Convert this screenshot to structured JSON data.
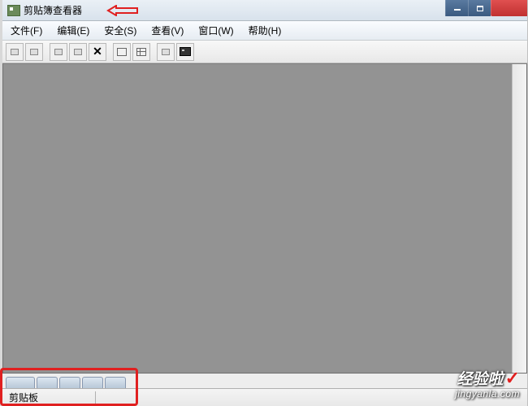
{
  "window": {
    "title": "剪贴簿查看器"
  },
  "menus": {
    "file": "文件(F)",
    "edit": "编辑(E)",
    "security": "安全(S)",
    "view": "查看(V)",
    "window": "窗口(W)",
    "help": "帮助(H)"
  },
  "statusbar": {
    "label": "剪贴板"
  },
  "watermark": {
    "main": "经验啦",
    "check": "✓",
    "sub": "jingyanla.com"
  },
  "colors": {
    "annotation_red": "#e02020",
    "content_bg": "#939393"
  }
}
